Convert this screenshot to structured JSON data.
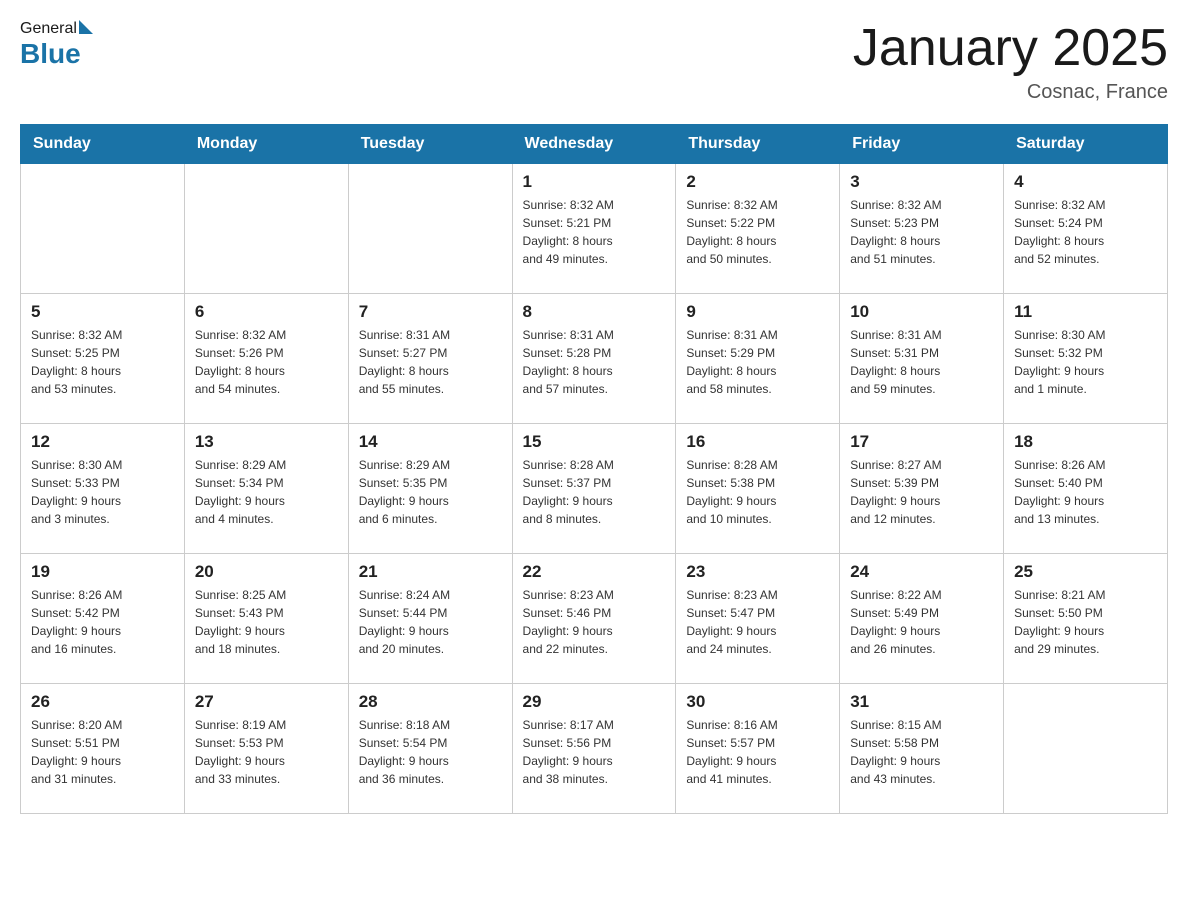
{
  "header": {
    "logo": {
      "general": "General",
      "blue": "Blue"
    },
    "title": "January 2025",
    "subtitle": "Cosnac, France"
  },
  "calendar": {
    "days_of_week": [
      "Sunday",
      "Monday",
      "Tuesday",
      "Wednesday",
      "Thursday",
      "Friday",
      "Saturday"
    ],
    "weeks": [
      [
        {
          "day": "",
          "info": ""
        },
        {
          "day": "",
          "info": ""
        },
        {
          "day": "",
          "info": ""
        },
        {
          "day": "1",
          "info": "Sunrise: 8:32 AM\nSunset: 5:21 PM\nDaylight: 8 hours\nand 49 minutes."
        },
        {
          "day": "2",
          "info": "Sunrise: 8:32 AM\nSunset: 5:22 PM\nDaylight: 8 hours\nand 50 minutes."
        },
        {
          "day": "3",
          "info": "Sunrise: 8:32 AM\nSunset: 5:23 PM\nDaylight: 8 hours\nand 51 minutes."
        },
        {
          "day": "4",
          "info": "Sunrise: 8:32 AM\nSunset: 5:24 PM\nDaylight: 8 hours\nand 52 minutes."
        }
      ],
      [
        {
          "day": "5",
          "info": "Sunrise: 8:32 AM\nSunset: 5:25 PM\nDaylight: 8 hours\nand 53 minutes."
        },
        {
          "day": "6",
          "info": "Sunrise: 8:32 AM\nSunset: 5:26 PM\nDaylight: 8 hours\nand 54 minutes."
        },
        {
          "day": "7",
          "info": "Sunrise: 8:31 AM\nSunset: 5:27 PM\nDaylight: 8 hours\nand 55 minutes."
        },
        {
          "day": "8",
          "info": "Sunrise: 8:31 AM\nSunset: 5:28 PM\nDaylight: 8 hours\nand 57 minutes."
        },
        {
          "day": "9",
          "info": "Sunrise: 8:31 AM\nSunset: 5:29 PM\nDaylight: 8 hours\nand 58 minutes."
        },
        {
          "day": "10",
          "info": "Sunrise: 8:31 AM\nSunset: 5:31 PM\nDaylight: 8 hours\nand 59 minutes."
        },
        {
          "day": "11",
          "info": "Sunrise: 8:30 AM\nSunset: 5:32 PM\nDaylight: 9 hours\nand 1 minute."
        }
      ],
      [
        {
          "day": "12",
          "info": "Sunrise: 8:30 AM\nSunset: 5:33 PM\nDaylight: 9 hours\nand 3 minutes."
        },
        {
          "day": "13",
          "info": "Sunrise: 8:29 AM\nSunset: 5:34 PM\nDaylight: 9 hours\nand 4 minutes."
        },
        {
          "day": "14",
          "info": "Sunrise: 8:29 AM\nSunset: 5:35 PM\nDaylight: 9 hours\nand 6 minutes."
        },
        {
          "day": "15",
          "info": "Sunrise: 8:28 AM\nSunset: 5:37 PM\nDaylight: 9 hours\nand 8 minutes."
        },
        {
          "day": "16",
          "info": "Sunrise: 8:28 AM\nSunset: 5:38 PM\nDaylight: 9 hours\nand 10 minutes."
        },
        {
          "day": "17",
          "info": "Sunrise: 8:27 AM\nSunset: 5:39 PM\nDaylight: 9 hours\nand 12 minutes."
        },
        {
          "day": "18",
          "info": "Sunrise: 8:26 AM\nSunset: 5:40 PM\nDaylight: 9 hours\nand 13 minutes."
        }
      ],
      [
        {
          "day": "19",
          "info": "Sunrise: 8:26 AM\nSunset: 5:42 PM\nDaylight: 9 hours\nand 16 minutes."
        },
        {
          "day": "20",
          "info": "Sunrise: 8:25 AM\nSunset: 5:43 PM\nDaylight: 9 hours\nand 18 minutes."
        },
        {
          "day": "21",
          "info": "Sunrise: 8:24 AM\nSunset: 5:44 PM\nDaylight: 9 hours\nand 20 minutes."
        },
        {
          "day": "22",
          "info": "Sunrise: 8:23 AM\nSunset: 5:46 PM\nDaylight: 9 hours\nand 22 minutes."
        },
        {
          "day": "23",
          "info": "Sunrise: 8:23 AM\nSunset: 5:47 PM\nDaylight: 9 hours\nand 24 minutes."
        },
        {
          "day": "24",
          "info": "Sunrise: 8:22 AM\nSunset: 5:49 PM\nDaylight: 9 hours\nand 26 minutes."
        },
        {
          "day": "25",
          "info": "Sunrise: 8:21 AM\nSunset: 5:50 PM\nDaylight: 9 hours\nand 29 minutes."
        }
      ],
      [
        {
          "day": "26",
          "info": "Sunrise: 8:20 AM\nSunset: 5:51 PM\nDaylight: 9 hours\nand 31 minutes."
        },
        {
          "day": "27",
          "info": "Sunrise: 8:19 AM\nSunset: 5:53 PM\nDaylight: 9 hours\nand 33 minutes."
        },
        {
          "day": "28",
          "info": "Sunrise: 8:18 AM\nSunset: 5:54 PM\nDaylight: 9 hours\nand 36 minutes."
        },
        {
          "day": "29",
          "info": "Sunrise: 8:17 AM\nSunset: 5:56 PM\nDaylight: 9 hours\nand 38 minutes."
        },
        {
          "day": "30",
          "info": "Sunrise: 8:16 AM\nSunset: 5:57 PM\nDaylight: 9 hours\nand 41 minutes."
        },
        {
          "day": "31",
          "info": "Sunrise: 8:15 AM\nSunset: 5:58 PM\nDaylight: 9 hours\nand 43 minutes."
        },
        {
          "day": "",
          "info": ""
        }
      ]
    ]
  }
}
